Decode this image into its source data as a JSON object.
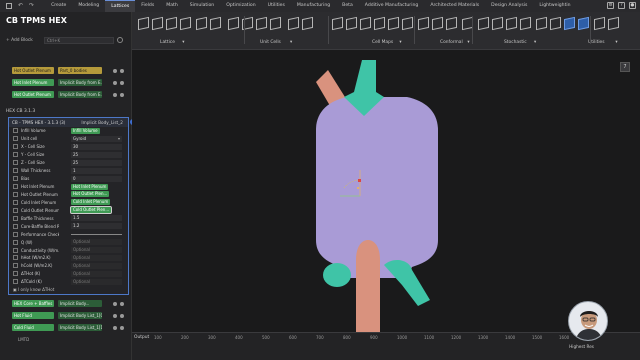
{
  "menu": {
    "tabs": [
      "Create",
      "Modeling",
      "Lattices",
      "Fields",
      "Math",
      "Simulation",
      "Optimization",
      "Utilities",
      "Manufacturing",
      "Beta",
      "Additive Manufacturing",
      "Architected Materials",
      "Design Analysis",
      "Lightweightin"
    ],
    "active_tab": "Lattices"
  },
  "panel": {
    "title": "CB TPMS HEX",
    "add_block": "Add Block",
    "search_shortcut": "Ctrl+K",
    "rows_top": [
      {
        "label": "Hot Outlet Plenum",
        "chip": "Part_0 bodies"
      },
      {
        "label": "Hot Inlet Plenum",
        "chip": "Implicit Body from E..."
      },
      {
        "label": "Hot Outlet Plenum",
        "chip": "Implicit Body from E..."
      }
    ],
    "group_label": "HEX CB 3.1.3",
    "block": {
      "name": "CB - TPMS HEX - 3.1.3 (3)",
      "output": "Implicit Body_List_2",
      "params": [
        {
          "label": "Infill Volume",
          "chip": "Infill Volume"
        },
        {
          "label": "Unit cell",
          "value": "Gyroid"
        },
        {
          "label": "X - Cell Size",
          "value": "30"
        },
        {
          "label": "Y - Cell Size",
          "value": "25"
        },
        {
          "label": "Z - Cell Size",
          "value": "25"
        },
        {
          "label": "Wall Thickness",
          "value": "1"
        },
        {
          "label": "Bias",
          "value": "0"
        },
        {
          "label": "Hot Inlet Plenum",
          "chip": "Hot Inlet Plenum"
        },
        {
          "label": "Hot Outlet Plenum",
          "chip": "Hot Outlet Plen..."
        },
        {
          "label": "Cold Inlet Plenum",
          "chip": "Cold Inlet Plenum"
        },
        {
          "label": "Cold Outlet Plenum",
          "chip": "Cold Outlet Plen..."
        },
        {
          "label": "Baffle Thickness",
          "value": "1.5"
        },
        {
          "label": "Core-Baffle Blend Ra...",
          "value": "1.2"
        },
        {
          "label": "Performance Checker",
          "value": ""
        },
        {
          "label": "Q (W)",
          "value": "Optional"
        },
        {
          "label": "Conductivity (W/m.K)",
          "value": "Optional"
        },
        {
          "label": "hHot (W/m2.K)",
          "value": "Optional"
        },
        {
          "label": "hCold (W/m2.K)",
          "value": "Optional"
        },
        {
          "label": "ΔTHot (K)",
          "value": "Optional"
        },
        {
          "label": "ΔTCold (K)",
          "value": "Optional"
        }
      ],
      "footer": "I only know ΔTHot"
    },
    "rows_bottom": [
      {
        "label": "HEX Core + Baffles",
        "chip": "Implicit Body..."
      },
      {
        "label": "Hot Fluid",
        "chip": "Implicit Body List_1[0]"
      },
      {
        "label": "Cold Fluid",
        "chip": "Implicit Body List_1[1]"
      }
    ],
    "footer_label": "LMTD"
  },
  "ribbon": {
    "groups": [
      "Lattice",
      "Unit Cells",
      "Cell Maps",
      "Conformal",
      "Stochastic",
      "Utilities"
    ]
  },
  "viewport": {
    "collapse_label": "7",
    "colors": {
      "core": "#a99bd6",
      "hot": "#d9927e",
      "cold": "#3fc4a7"
    }
  },
  "timeline": {
    "output_label": "Output",
    "ticks": [
      "100",
      "200",
      "300",
      "400",
      "500",
      "600",
      "700",
      "800",
      "900",
      "1000",
      "1100",
      "1200",
      "1300",
      "1400",
      "1500",
      "1600",
      "1700"
    ],
    "quality_label": "Highest Res"
  }
}
